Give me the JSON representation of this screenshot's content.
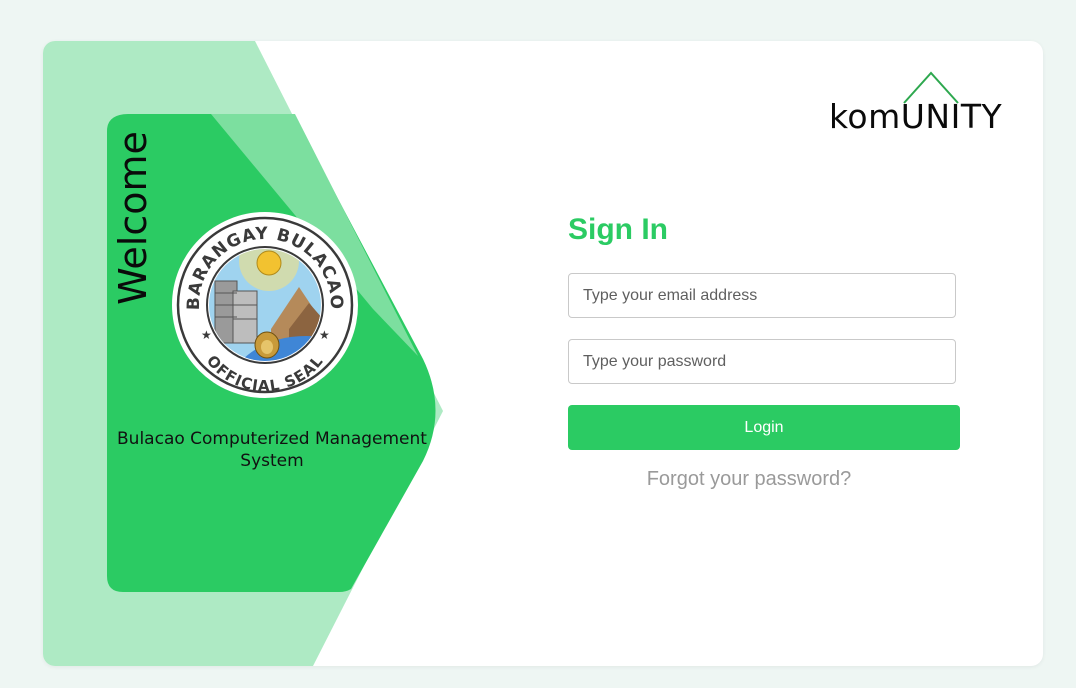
{
  "welcome_panel": {
    "welcome_text": "Welcome",
    "seal_text_top": "BARANGAY BULACAO",
    "seal_text_bottom": "OFFICIAL SEAL",
    "system_name": "Bulacao Computerized Management System"
  },
  "brand": {
    "logo_text": "komUNITY"
  },
  "login_form": {
    "title": "Sign In",
    "email_placeholder": "Type your email address",
    "password_placeholder": "Type your password",
    "login_label": "Login",
    "forgot_link": "Forgot your password?"
  },
  "colors": {
    "primary_green": "#2bcb63",
    "light_green": "#aeeac4",
    "page_background": "#eef6f3"
  }
}
